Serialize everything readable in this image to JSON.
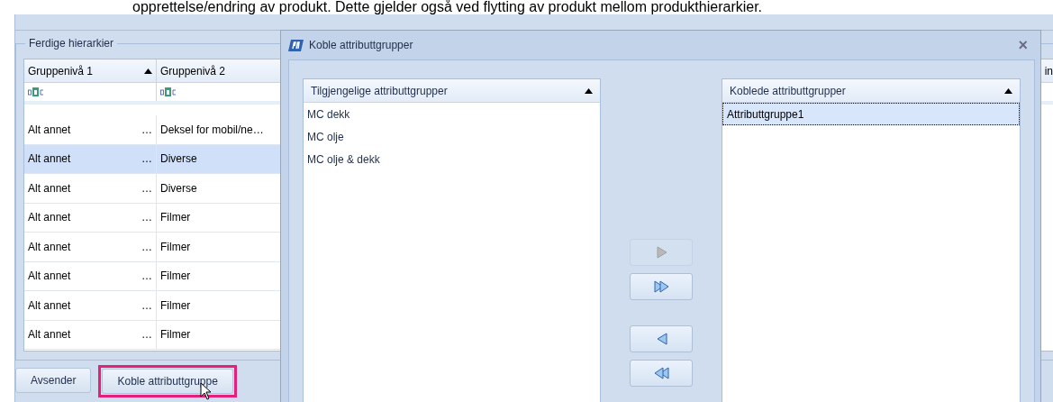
{
  "document_text": "opprettelse/endring av produkt. Dette gjelder også ved flytting av produkt mellom produkthierarkier.",
  "group": {
    "title": "Ferdige hierarkier",
    "columns": [
      {
        "label": "Gruppenivå 1",
        "sorted": true
      },
      {
        "label": "Gruppenivå 2",
        "sorted": false
      }
    ],
    "rows": [
      {
        "cells": [
          "Alt annet",
          "Deksel for mobil/ne…"
        ],
        "selected": false
      },
      {
        "cells": [
          "Alt annet",
          "Diverse"
        ],
        "selected": true
      },
      {
        "cells": [
          "Alt annet",
          "Diverse"
        ],
        "selected": false
      },
      {
        "cells": [
          "Alt annet",
          "Filmer"
        ],
        "selected": false
      },
      {
        "cells": [
          "Alt annet",
          "Filmer"
        ],
        "selected": false
      },
      {
        "cells": [
          "Alt annet",
          "Filmer"
        ],
        "selected": false
      },
      {
        "cells": [
          "Alt annet",
          "Filmer"
        ],
        "selected": false
      },
      {
        "cells": [
          "Alt annet",
          "Filmer"
        ],
        "selected": false
      }
    ],
    "ellipsis": "…",
    "buttons": [
      {
        "label": "Avsender",
        "highlighted": false
      },
      {
        "label": "Koble attributtgruppe",
        "highlighted": true
      }
    ],
    "right_column_fragment": "in"
  },
  "dialog": {
    "title": "Koble attributtgrupper",
    "close": "×",
    "available": {
      "header": "Tilgjengelige attributtgrupper",
      "items": [
        {
          "label": "MC dekk",
          "selected": false
        },
        {
          "label": "MC olje",
          "selected": false
        },
        {
          "label": "MC olje & dekk",
          "selected": false
        }
      ]
    },
    "linked": {
      "header": "Koblede attributtgrupper",
      "items": [
        {
          "label": "Attributtgruppe1",
          "selected": true
        }
      ]
    },
    "move_buttons": [
      {
        "kind": "add",
        "disabled": true
      },
      {
        "kind": "add_all",
        "disabled": false
      },
      {
        "kind": "remove",
        "disabled": false
      },
      {
        "kind": "remove_all",
        "disabled": false
      }
    ]
  }
}
